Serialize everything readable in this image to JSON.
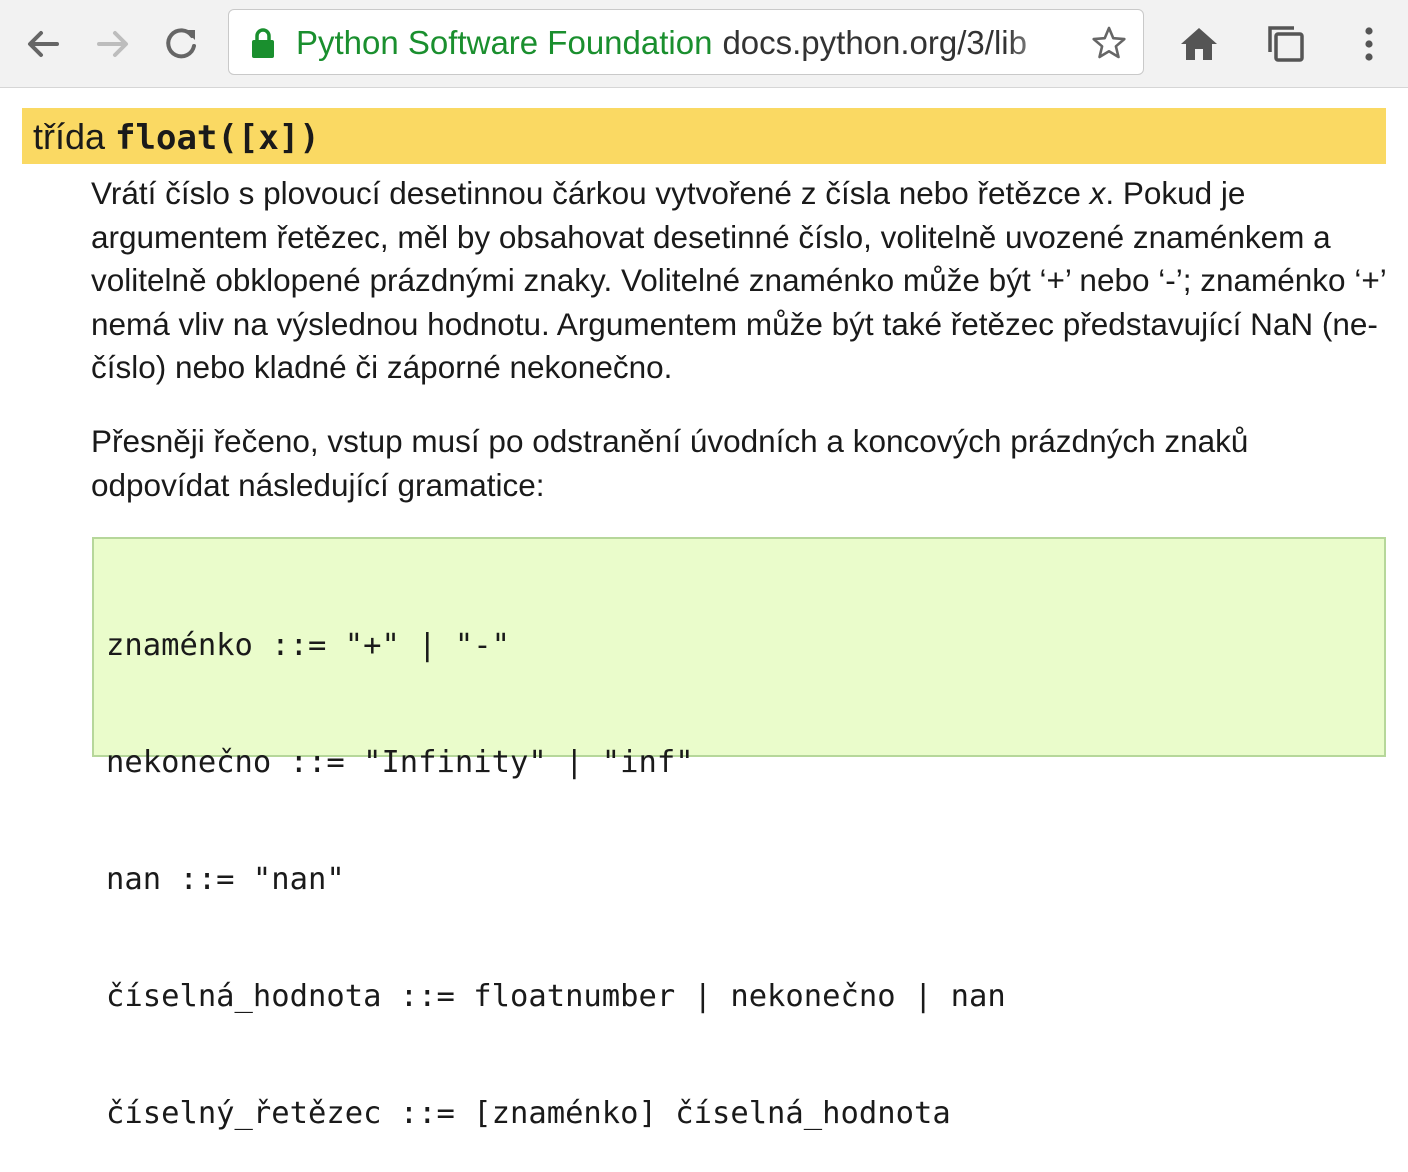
{
  "browser": {
    "url_org": "Python Software Foundation",
    "url_host": "docs.python.org/3/lib",
    "icons": {
      "back": "back-arrow-icon",
      "forward": "forward-arrow-icon",
      "reload": "reload-icon",
      "lock": "lock-icon",
      "bookmark": "star-icon",
      "home": "home-icon",
      "tabs": "tabs-icon",
      "menu": "menu-kebab-icon"
    },
    "colors": {
      "secure": "#1a8f2e",
      "toolbar": "#f2f2f2"
    }
  },
  "doc": {
    "signature_kind": "třída",
    "signature_name": "float([x])",
    "paragraph1_a": "Vrátí číslo s plovoucí desetinnou čárkou vytvořené z čísla nebo řetězce ",
    "paragraph1_var": "x",
    "paragraph1_b": ". Pokud je argumentem řetězec, měl by obsahovat desetinné číslo, volitelně uvozené znaménkem a volitelně obklopené prázdnými znaky. Volitelné znaménko může být ‘+’ nebo ‘-’; znaménko ‘+’ nemá vliv na výslednou hodnotu. Argumentem může být také řetězec představující NaN (ne-číslo) nebo kladné či záporné nekonečno.",
    "paragraph2": "Přesněji řečeno, vstup musí po odstranění úvodních a koncových prázdných znaků odpovídat následující gramatice:",
    "grammar": [
      "znaménko ::= \"+\" | \"-\"",
      "nekonečno ::= \"Infinity\" | \"inf\"",
      "nan ::= \"nan\"",
      "číselná_hodnota ::= floatnumber | nekonečno | nan",
      "číselný_řetězec ::= [znaménko] číselná_hodnota"
    ],
    "colors": {
      "signature_bg": "#fad963",
      "grammar_bg": "#eafccb",
      "grammar_border": "#b6d79a"
    }
  }
}
